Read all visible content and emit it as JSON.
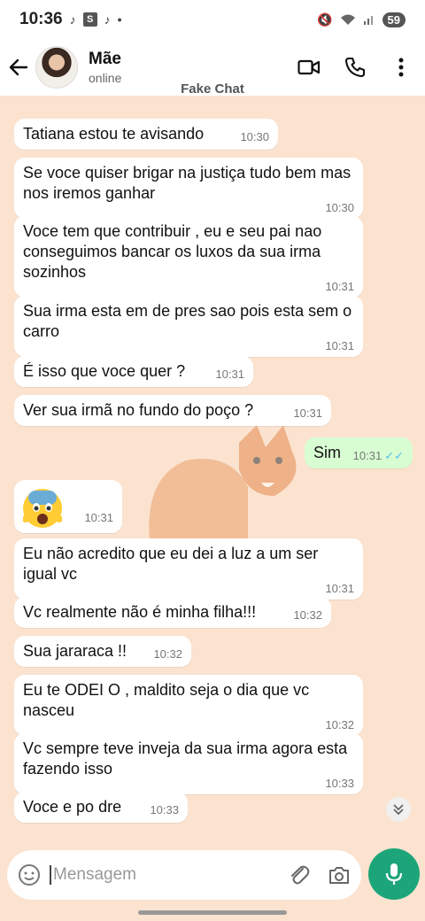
{
  "status_bar": {
    "time": "10:36",
    "battery": "59"
  },
  "header": {
    "contact_name": "Mãe",
    "contact_status": "online"
  },
  "watermark": {
    "title": "Fake Chat"
  },
  "messages": [
    {
      "text": "Tatiana estou te avisando",
      "time": "10:30",
      "direction": "in"
    },
    {
      "text": "Se voce quiser brigar na justiça tudo bem mas nos iremos ganhar",
      "time": "10:30",
      "direction": "in"
    },
    {
      "text": "Voce tem que contribuir , eu e seu pai nao conseguimos bancar os luxos da sua irma sozinhos",
      "time": "10:31",
      "direction": "in"
    },
    {
      "text": "Sua irma esta em de pres sao pois esta sem o carro",
      "time": "10:31",
      "direction": "in"
    },
    {
      "text": "É isso que voce quer ?",
      "time": "10:31",
      "direction": "in"
    },
    {
      "text": "Ver sua irmã no fundo do poço ?",
      "time": "10:31",
      "direction": "in"
    },
    {
      "text": "Sim",
      "time": "10:31",
      "direction": "out"
    },
    {
      "text": "",
      "emoji": "fearful-face",
      "time": "10:31",
      "direction": "in"
    },
    {
      "text": "Eu não acredito que eu dei a luz a um ser igual vc",
      "time": "10:31",
      "direction": "in"
    },
    {
      "text": "Vc realmente não é minha filha!!!",
      "time": "10:32",
      "direction": "in"
    },
    {
      "text": "Sua jararaca !!",
      "time": "10:32",
      "direction": "in"
    },
    {
      "text": "Eu te ODEI O , maldito seja o dia que vc nasceu",
      "time": "10:32",
      "direction": "in"
    },
    {
      "text": "Vc sempre teve inveja da sua irma agora esta fazendo isso",
      "time": "10:33",
      "direction": "in"
    },
    {
      "text": "Voce e po dre",
      "time": "10:33",
      "direction": "in"
    }
  ],
  "input": {
    "placeholder": "Mensagem"
  },
  "colors": {
    "incoming_bubble": "#ffffff",
    "outgoing_bubble": "#d9fdd3",
    "chat_background": "#fbe3d0",
    "mic_button": "#1da57a",
    "read_ticks": "#53bdeb"
  }
}
